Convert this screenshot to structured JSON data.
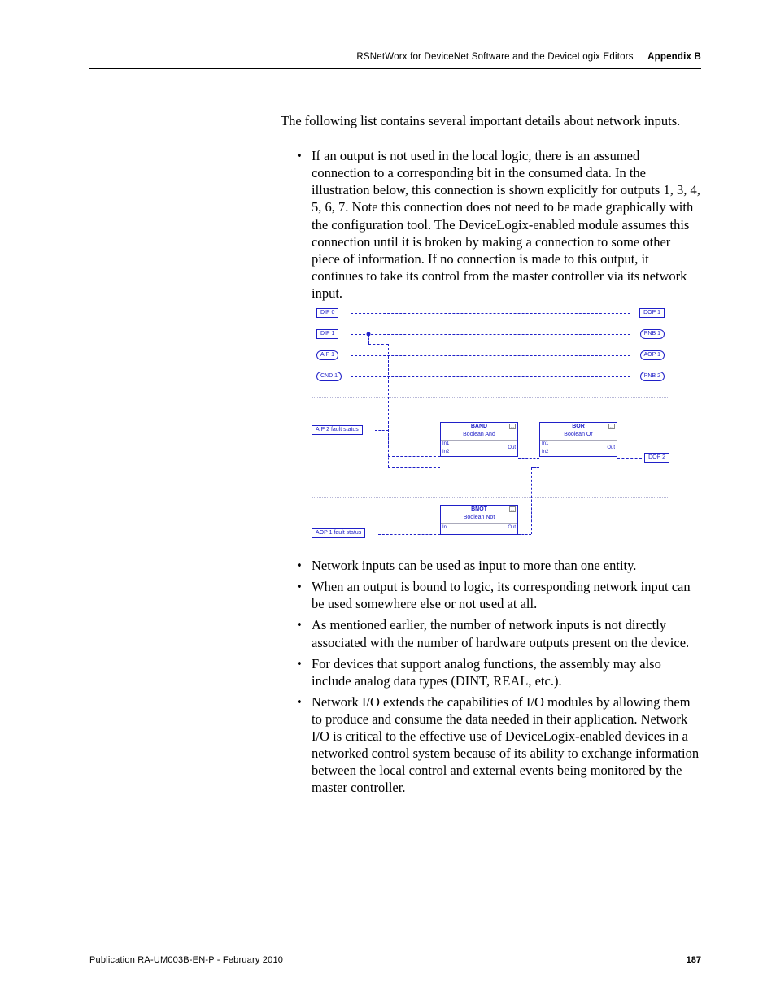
{
  "header": {
    "title": "RSNetWorx for DeviceNet Software and the DeviceLogix Editors",
    "appendix": "Appendix B"
  },
  "intro": "The following list contains several important details about network inputs.",
  "bullets_top": [
    "If an output is not used in the local logic, there is an assumed connection to a corresponding bit in the consumed data. In the illustration below, this connection is shown explicitly for outputs 1, 3, 4, 5, 6, 7. Note this connection does not need to be made graphically with the configuration tool. The DeviceLogix-enabled module assumes this connection until it is broken by making a connection to some other piece of information. If no connection is made to this output, it continues to take its control from the master controller via its network input."
  ],
  "bullets_bottom": [
    "Network inputs can be used as input to more than one entity.",
    "When an output is bound to logic, its corresponding network input can be used somewhere else or not used at all.",
    "As mentioned earlier, the number of network inputs is not directly associated with the number of hardware outputs present on the device.",
    "For devices that support analog functions, the assembly may also include analog data types (DINT, REAL, etc.).",
    "Network I/O extends the capabilities of I/O modules by allowing them to produce and consume the data needed in their application. Network I/O is critical to the effective use of DeviceLogix-enabled devices in a networked control system because of its ability to exchange information between the local control and external events being monitored by the master controller."
  ],
  "diagram": {
    "left_tags": {
      "dip0": "DIP 0",
      "dip1": "DIP 1",
      "aip1": "AIP 1",
      "cnd1": "CND 1",
      "aip2fault": "AIP 2 fault status",
      "aop1fault": "AOP 1 fault status"
    },
    "right_tags": {
      "dop1": "DOP 1",
      "pnb1": "PNB 1",
      "aop1": "AOP 1",
      "pnb2": "PNB 2",
      "dop2": "DOP 2"
    },
    "gates": {
      "band": {
        "title": "BAND",
        "sub": "Boolean And",
        "in1": "In1",
        "in2": "In2",
        "out": "Out"
      },
      "bor": {
        "title": "BOR",
        "sub": "Boolean Or",
        "in1": "In1",
        "in2": "In2",
        "out": "Out"
      },
      "bnot": {
        "title": "BNOT",
        "sub": "Boolean Not",
        "in": "In",
        "out": "Out"
      }
    }
  },
  "footer": {
    "publication": "Publication RA-UM003B-EN-P - February 2010",
    "page": "187"
  }
}
